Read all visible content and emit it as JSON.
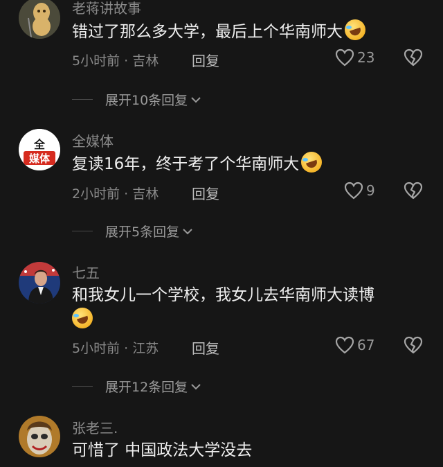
{
  "comments": [
    {
      "username": "老蒋讲故事",
      "text": "错过了那么多大学，最后上个华南师大",
      "meta": "5小时前 · 吉林",
      "reply_label": "回复",
      "likes": "23",
      "expand_label": "展开10条回复",
      "avatar": "peanut-avatar"
    },
    {
      "username": "全媒体",
      "text": "复读16年，终于考了个华南师大",
      "meta": "2小时前 · 吉林",
      "reply_label": "回复",
      "likes": "9",
      "expand_label": "展开5条回复",
      "avatar_text": "全媒体",
      "avatar_line1": "全",
      "avatar_line2": "媒体"
    },
    {
      "username": "七五",
      "text_line1": "和我女儿一个学校，我女儿去华南师大读博",
      "meta": "5小时前 · 江苏",
      "reply_label": "回复",
      "likes": "67",
      "expand_label": "展开12条回复",
      "avatar": "man-portrait-avatar"
    },
    {
      "username": "张老三.",
      "text": "可惜了 中国政法大学没去",
      "avatar": "clown-face-avatar"
    }
  ],
  "icons": {
    "emoji": "laughing-tears-emoji",
    "like": "heart-icon",
    "dislike": "broken-heart-icon",
    "expand": "chevron-down-icon"
  },
  "colors": {
    "background": "#161616",
    "text": "#efefef",
    "muted": "#8a8a8a"
  }
}
